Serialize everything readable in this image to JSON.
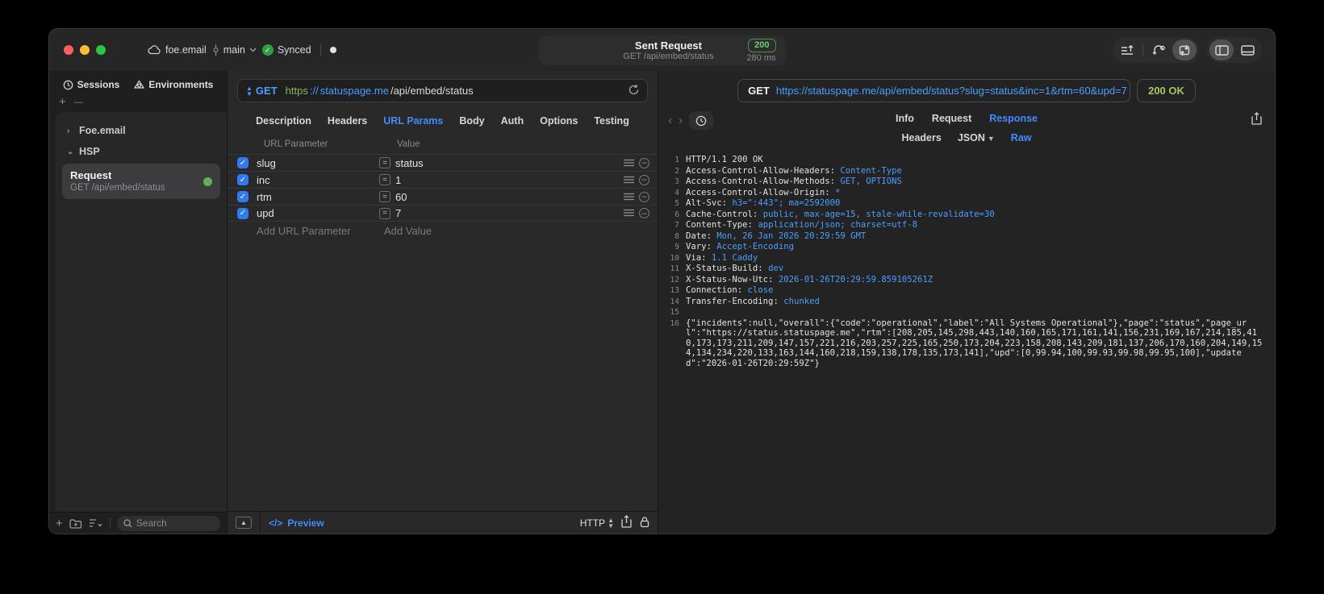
{
  "colors": {
    "accent_blue": "#3f8cff",
    "url_blue": "#4b9fff",
    "scheme_green": "#8fb562",
    "badge_green": "#6fce73",
    "ok_green": "#a9c665",
    "checkbox_blue": "#2f7af7",
    "traffic_red": "#ff5f57",
    "traffic_yellow": "#febc2e",
    "traffic_green": "#28c840",
    "sync_green": "#2ea043",
    "request_dot_green": "#5bb450"
  },
  "titlebar": {
    "project": "foe.email",
    "branch": "main",
    "sync_label": "Synced",
    "title": "Sent Request",
    "subtitle": "GET /api/embed/status",
    "status_code": "200",
    "duration": "280 ms"
  },
  "sidebar": {
    "tabs": [
      "Sessions",
      "Environments"
    ],
    "plus": "+",
    "minus": "—",
    "tree": [
      {
        "label": "Foe.email",
        "chevron": "›"
      },
      {
        "label": "HSP",
        "chevron": "⌄"
      }
    ],
    "request_item": {
      "title": "Request",
      "subtitle": "GET /api/embed/status"
    },
    "search_placeholder": "Search"
  },
  "request_panel": {
    "method": "GET",
    "url_scheme": "https",
    "url_sep": "://",
    "url_host": "statuspage.me",
    "url_path": "/api/embed/status",
    "tabs": [
      "Description",
      "Headers",
      "URL Params",
      "Body",
      "Auth",
      "Options",
      "Testing"
    ],
    "active_tab": "URL Params",
    "table": {
      "col1": "URL Parameter",
      "col2": "Value",
      "rows": [
        {
          "checked": true,
          "name": "slug",
          "value": "status"
        },
        {
          "checked": true,
          "name": "inc",
          "value": "1"
        },
        {
          "checked": true,
          "name": "rtm",
          "value": "60"
        },
        {
          "checked": true,
          "name": "upd",
          "value": "7"
        }
      ],
      "add_name": "Add URL Parameter",
      "add_value": "Add Value"
    },
    "footer": {
      "preview_label": "Preview",
      "preview_glyph": "</>",
      "protocol": "HTTP"
    }
  },
  "response_panel": {
    "method": "GET",
    "url": "https://statuspage.me/api/embed/status?slug=status&inc=1&rtm=60&upd=7",
    "status": "200 OK",
    "tabs": [
      "Info",
      "Request",
      "Response"
    ],
    "active_tab": "Response",
    "subtabs": [
      "Headers",
      "JSON",
      "Raw"
    ],
    "active_subtab": "Raw",
    "status_line": "HTTP/1.1 200 OK",
    "headers": [
      {
        "name": "Access-Control-Allow-Headers",
        "value": "Content-Type"
      },
      {
        "name": "Access-Control-Allow-Methods",
        "value": "GET, OPTIONS"
      },
      {
        "name": "Access-Control-Allow-Origin",
        "value": "*"
      },
      {
        "name": "Alt-Svc",
        "value": "h3=\":443\"; ma=2592000"
      },
      {
        "name": "Cache-Control",
        "value": "public, max-age=15, stale-while-revalidate=30"
      },
      {
        "name": "Content-Type",
        "value": "application/json; charset=utf-8"
      },
      {
        "name": "Date",
        "value": "Mon, 26 Jan 2026 20:29:59 GMT"
      },
      {
        "name": "Vary",
        "value": "Accept-Encoding"
      },
      {
        "name": "Via",
        "value": "1.1 Caddy"
      },
      {
        "name": "X-Status-Build",
        "value": "dev"
      },
      {
        "name": "X-Status-Now-Utc",
        "value": "2026-01-26T20:29:59.859105261Z"
      },
      {
        "name": "Connection",
        "value": "close"
      },
      {
        "name": "Transfer-Encoding",
        "value": "chunked"
      }
    ],
    "body": "{\"incidents\":null,\"overall\":{\"code\":\"operational\",\"label\":\"All Systems Operational\"},\"page\":\"status\",\"page_url\":\"https://status.statuspage.me\",\"rtm\":[208,205,145,298,443,140,160,165,171,161,141,156,231,169,167,214,185,410,173,173,211,209,147,157,221,216,203,257,225,165,250,173,204,223,158,208,143,209,181,137,206,170,160,204,149,154,134,234,220,133,163,144,160,218,159,138,178,135,173,141],\"upd\":[0,99.94,100,99.93,99.98,99.95,100],\"updated\":\"2026-01-26T20:29:59Z\"}"
  }
}
